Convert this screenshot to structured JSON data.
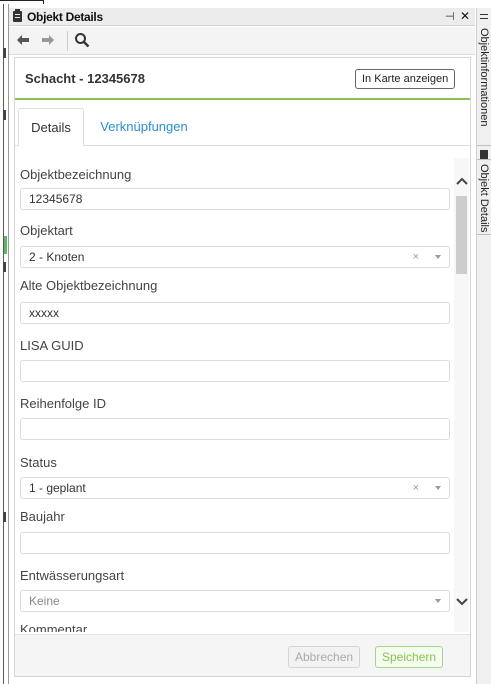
{
  "window": {
    "title": "Objekt Details",
    "pin_glyph": "⊣",
    "close_glyph": "✕"
  },
  "toolbar": {
    "back_icon": "arrow-left-icon",
    "forward_icon": "arrow-right-icon",
    "search_icon": "search-icon"
  },
  "panel": {
    "title": "Schacht - 12345678",
    "map_button_label": "In Karte anzeigen",
    "accent_color": "#8cc152",
    "link_color": "#2a8fd0"
  },
  "tabs": [
    {
      "label": "Details",
      "active": true
    },
    {
      "label": "Verknüpfungen",
      "active": false
    }
  ],
  "fields": {
    "objektbezeichnung": {
      "label": "Objektbezeichnung",
      "value": "12345678"
    },
    "objektart": {
      "label": "Objektart",
      "value": "2 - Knoten",
      "clear": "×"
    },
    "alte_objektbezeichnung": {
      "label": "Alte Objektbezeichnung",
      "value": "xxxxx"
    },
    "lisa_guid": {
      "label": "LISA GUID",
      "value": ""
    },
    "reihenfolge_id": {
      "label": "Reihenfolge ID",
      "value": ""
    },
    "status": {
      "label": "Status",
      "value": "1 - geplant",
      "clear": "×"
    },
    "baujahr": {
      "label": "Baujahr",
      "value": ""
    },
    "entwaesserungsart": {
      "label": "Entwässerungsart",
      "value": "Keine"
    },
    "kommentar": {
      "label": "Kommentar"
    }
  },
  "footer": {
    "cancel_label": "Abbrechen",
    "save_label": "Speichern"
  },
  "side_tabs": [
    {
      "label": "Objektinformationen",
      "icon": "list-icon"
    },
    {
      "label": "Objekt Details",
      "icon": "clipboard-icon"
    }
  ]
}
